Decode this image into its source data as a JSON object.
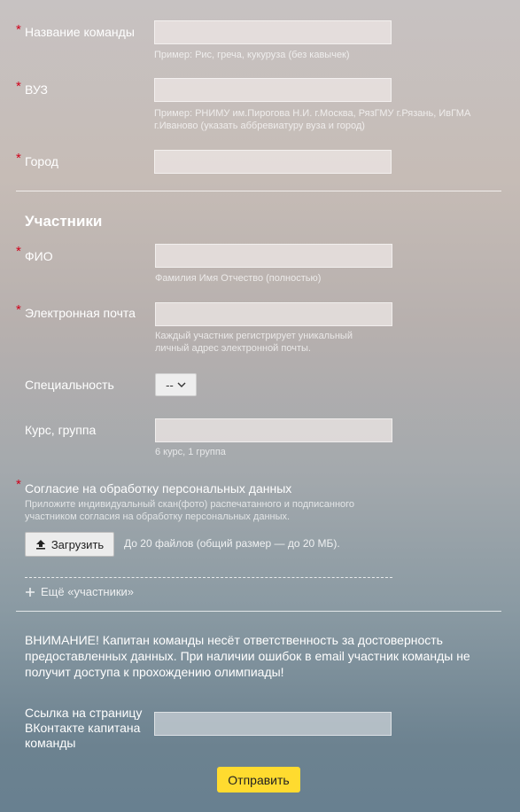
{
  "team": {
    "name_label": "Название команды",
    "name_hint": "Пример: Рис, греча, кукуруза (без кавычек)",
    "university_label": "ВУЗ",
    "university_hint_line1": "Пример: РНИМУ им.Пирогова Н.И. г.Москва, РязГМУ г.Рязань, ИвГМА",
    "university_hint_line2": "г.Иваново (указать аббревиатуру вуза и город)",
    "city_label": "Город"
  },
  "participants": {
    "section_title": "Участники",
    "fio_label": "ФИО",
    "fio_hint": "Фамилия Имя Отчество (полностью)",
    "email_label": "Электронная почта",
    "email_hint_line1": "Каждый участник регистрирует уникальный",
    "email_hint_line2": "личный адрес электронной почты.",
    "specialty_label": "Специальность",
    "specialty_value": "--",
    "course_label": "Курс, группа",
    "course_hint": "6 курс, 1 группа",
    "consent_label": "Согласие на обработку персональных данных",
    "consent_hint_line1": "Приложите индивидуальный скан(фото) распечатанного и подписанного",
    "consent_hint_line2": "участником согласия на обработку персональных данных.",
    "upload_label": "Загрузить",
    "upload_hint": "До 20 файлов (общий размер — до 20 МБ).",
    "add_more_label": "Ещё «участники»"
  },
  "warning_line1": "ВНИМАНИЕ! Капитан команды несёт ответственность за достоверность",
  "warning_line2": "предоставленных данных. При наличии ошибок в email участник команды не",
  "warning_line3": "получит доступа к прохождению олимпиады!",
  "vk": {
    "label_line1": "Ссылка на страницу",
    "label_line2": "ВКонтакте капитана",
    "label_line3": "команды"
  },
  "submit_label": "Отправить",
  "required_mark": "*",
  "colors": {
    "required": "#d0021b",
    "submit_button": "#ffdb2f"
  },
  "icons": {
    "upload": "upload-icon",
    "chevron": "chevron-down-icon",
    "plus": "plus-icon"
  }
}
